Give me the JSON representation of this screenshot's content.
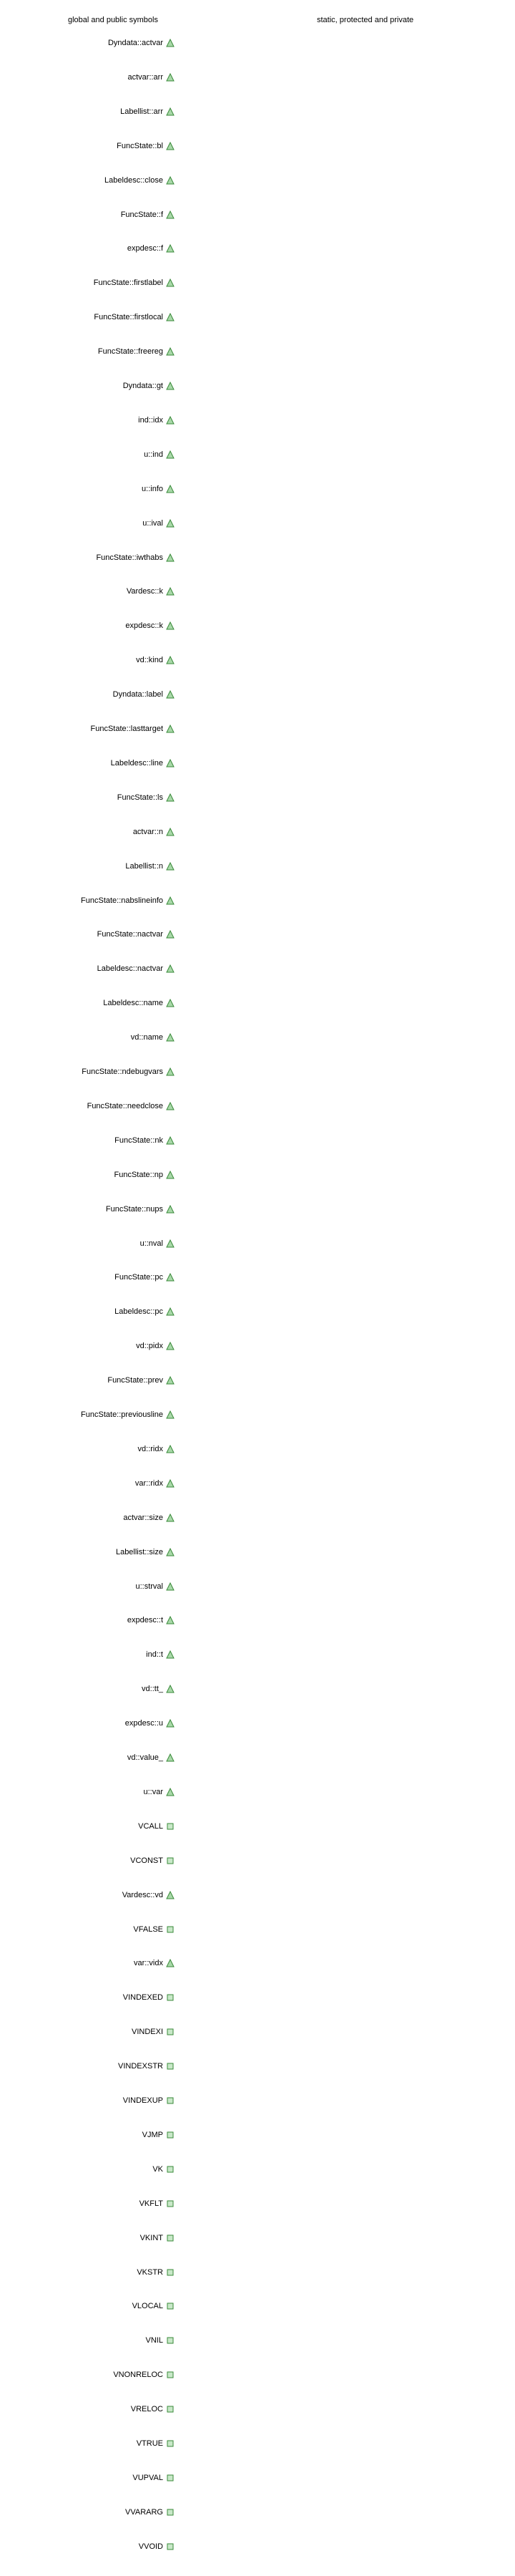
{
  "headers": {
    "left": "global and public symbols",
    "right": "static, protected and private"
  },
  "colors": {
    "triangle_fill": "#a8d8a8",
    "triangle_stroke": "#3a8a3a",
    "square_fill": "#c8e8c8",
    "square_stroke": "#3a8a3a"
  },
  "symbols": [
    {
      "label": "Dyndata::actvar",
      "icon": "triangle"
    },
    {
      "label": "actvar::arr",
      "icon": "triangle"
    },
    {
      "label": "Labellist::arr",
      "icon": "triangle"
    },
    {
      "label": "FuncState::bl",
      "icon": "triangle"
    },
    {
      "label": "Labeldesc::close",
      "icon": "triangle"
    },
    {
      "label": "FuncState::f",
      "icon": "triangle"
    },
    {
      "label": "expdesc::f",
      "icon": "triangle"
    },
    {
      "label": "FuncState::firstlabel",
      "icon": "triangle"
    },
    {
      "label": "FuncState::firstlocal",
      "icon": "triangle"
    },
    {
      "label": "FuncState::freereg",
      "icon": "triangle"
    },
    {
      "label": "Dyndata::gt",
      "icon": "triangle"
    },
    {
      "label": "ind::idx",
      "icon": "triangle"
    },
    {
      "label": "u::ind",
      "icon": "triangle"
    },
    {
      "label": "u::info",
      "icon": "triangle"
    },
    {
      "label": "u::ival",
      "icon": "triangle"
    },
    {
      "label": "FuncState::iwthabs",
      "icon": "triangle"
    },
    {
      "label": "Vardesc::k",
      "icon": "triangle"
    },
    {
      "label": "expdesc::k",
      "icon": "triangle"
    },
    {
      "label": "vd::kind",
      "icon": "triangle"
    },
    {
      "label": "Dyndata::label",
      "icon": "triangle"
    },
    {
      "label": "FuncState::lasttarget",
      "icon": "triangle"
    },
    {
      "label": "Labeldesc::line",
      "icon": "triangle"
    },
    {
      "label": "FuncState::ls",
      "icon": "triangle"
    },
    {
      "label": "actvar::n",
      "icon": "triangle"
    },
    {
      "label": "Labellist::n",
      "icon": "triangle"
    },
    {
      "label": "FuncState::nabslineinfo",
      "icon": "triangle"
    },
    {
      "label": "FuncState::nactvar",
      "icon": "triangle"
    },
    {
      "label": "Labeldesc::nactvar",
      "icon": "triangle"
    },
    {
      "label": "Labeldesc::name",
      "icon": "triangle"
    },
    {
      "label": "vd::name",
      "icon": "triangle"
    },
    {
      "label": "FuncState::ndebugvars",
      "icon": "triangle"
    },
    {
      "label": "FuncState::needclose",
      "icon": "triangle"
    },
    {
      "label": "FuncState::nk",
      "icon": "triangle"
    },
    {
      "label": "FuncState::np",
      "icon": "triangle"
    },
    {
      "label": "FuncState::nups",
      "icon": "triangle"
    },
    {
      "label": "u::nval",
      "icon": "triangle"
    },
    {
      "label": "FuncState::pc",
      "icon": "triangle"
    },
    {
      "label": "Labeldesc::pc",
      "icon": "triangle"
    },
    {
      "label": "vd::pidx",
      "icon": "triangle"
    },
    {
      "label": "FuncState::prev",
      "icon": "triangle"
    },
    {
      "label": "FuncState::previousline",
      "icon": "triangle"
    },
    {
      "label": "vd::ridx",
      "icon": "triangle"
    },
    {
      "label": "var::ridx",
      "icon": "triangle"
    },
    {
      "label": "actvar::size",
      "icon": "triangle"
    },
    {
      "label": "Labellist::size",
      "icon": "triangle"
    },
    {
      "label": "u::strval",
      "icon": "triangle"
    },
    {
      "label": "expdesc::t",
      "icon": "triangle"
    },
    {
      "label": "ind::t",
      "icon": "triangle"
    },
    {
      "label": "vd::tt_",
      "icon": "triangle"
    },
    {
      "label": "expdesc::u",
      "icon": "triangle"
    },
    {
      "label": "vd::value_",
      "icon": "triangle"
    },
    {
      "label": "u::var",
      "icon": "triangle"
    },
    {
      "label": "VCALL",
      "icon": "square"
    },
    {
      "label": "VCONST",
      "icon": "square"
    },
    {
      "label": "Vardesc::vd",
      "icon": "triangle"
    },
    {
      "label": "VFALSE",
      "icon": "square"
    },
    {
      "label": "var::vidx",
      "icon": "triangle"
    },
    {
      "label": "VINDEXED",
      "icon": "square"
    },
    {
      "label": "VINDEXI",
      "icon": "square"
    },
    {
      "label": "VINDEXSTR",
      "icon": "square"
    },
    {
      "label": "VINDEXUP",
      "icon": "square"
    },
    {
      "label": "VJMP",
      "icon": "square"
    },
    {
      "label": "VK",
      "icon": "square"
    },
    {
      "label": "VKFLT",
      "icon": "square"
    },
    {
      "label": "VKINT",
      "icon": "square"
    },
    {
      "label": "VKSTR",
      "icon": "square"
    },
    {
      "label": "VLOCAL",
      "icon": "square"
    },
    {
      "label": "VNIL",
      "icon": "square"
    },
    {
      "label": "VNONRELOC",
      "icon": "square"
    },
    {
      "label": "VRELOC",
      "icon": "square"
    },
    {
      "label": "VTRUE",
      "icon": "square"
    },
    {
      "label": "VUPVAL",
      "icon": "square"
    },
    {
      "label": "VVARARG",
      "icon": "square"
    },
    {
      "label": "VVOID",
      "icon": "square"
    }
  ]
}
